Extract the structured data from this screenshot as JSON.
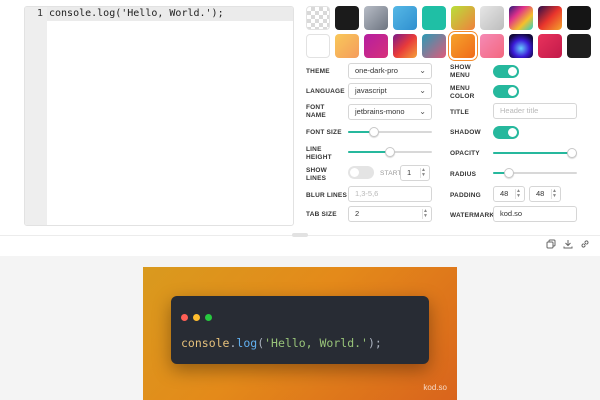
{
  "editor": {
    "line_number": "1",
    "code": "console.log('Hello, World.');"
  },
  "swatches": [
    {
      "name": "transparent",
      "selected": false
    },
    {
      "name": "black",
      "selected": false
    },
    {
      "name": "gray-gradient",
      "selected": false
    },
    {
      "name": "sky-blue",
      "selected": false
    },
    {
      "name": "teal",
      "selected": false
    },
    {
      "name": "lime-orange",
      "selected": false
    },
    {
      "name": "silver",
      "selected": false
    },
    {
      "name": "rainbow",
      "selected": false
    },
    {
      "name": "sunset-dark",
      "selected": false
    },
    {
      "name": "dark",
      "selected": false
    },
    {
      "name": "white",
      "selected": false
    },
    {
      "name": "peach",
      "selected": false
    },
    {
      "name": "magenta-purple",
      "selected": false
    },
    {
      "name": "crimson-orange",
      "selected": false
    },
    {
      "name": "teal-pink",
      "selected": false
    },
    {
      "name": "orange",
      "selected": true
    },
    {
      "name": "pink",
      "selected": false
    },
    {
      "name": "neon-blue",
      "selected": false
    },
    {
      "name": "raspberry",
      "selected": false
    },
    {
      "name": "dark-2",
      "selected": false
    }
  ],
  "settings": {
    "theme": {
      "label": "THEME",
      "value": "one-dark-pro"
    },
    "language": {
      "label": "LANGUAGE",
      "value": "javascript"
    },
    "font_name": {
      "label": "FONT NAME",
      "value": "jetbrains-mono"
    },
    "font_size": {
      "label": "FONT SIZE",
      "level": 0.28
    },
    "line_height": {
      "label": "LINE HEIGHT",
      "level": 0.5
    },
    "show_lines": {
      "label": "SHOW LINES",
      "start_label": "START",
      "start_value": "1",
      "on": false
    },
    "blur_lines": {
      "label": "BLUR LINES",
      "placeholder": "1,3-5,6"
    },
    "tab_size": {
      "label": "TAB SIZE",
      "value": "2"
    },
    "show_menu": {
      "label": "SHOW MENU",
      "on": true
    },
    "menu_color": {
      "label": "MENU COLOR",
      "on": true
    },
    "title": {
      "label": "TITLE",
      "placeholder": "Header title"
    },
    "shadow": {
      "label": "SHADOW",
      "on": true
    },
    "opacity": {
      "label": "OPACITY",
      "level": 1.0
    },
    "radius": {
      "label": "RADIUS",
      "level": 0.15
    },
    "padding": {
      "label": "PADDING",
      "x": "48",
      "y": "48"
    },
    "watermark": {
      "label": "WATERMARK",
      "value": "kod.so"
    }
  },
  "preview": {
    "code_object": "console",
    "code_dot": ".",
    "code_method": "log",
    "code_open": "(",
    "code_string": "'Hello, World.'",
    "code_close": ");",
    "watermark": "kod.so"
  },
  "colors": {
    "accent": "#26b89d",
    "keyword": "#e5c07b",
    "method": "#61afef",
    "string": "#98c379",
    "punct": "#abb2bf",
    "dot_red": "#ff5f56",
    "dot_yellow": "#ffbd2e",
    "dot_green": "#27c93f"
  }
}
